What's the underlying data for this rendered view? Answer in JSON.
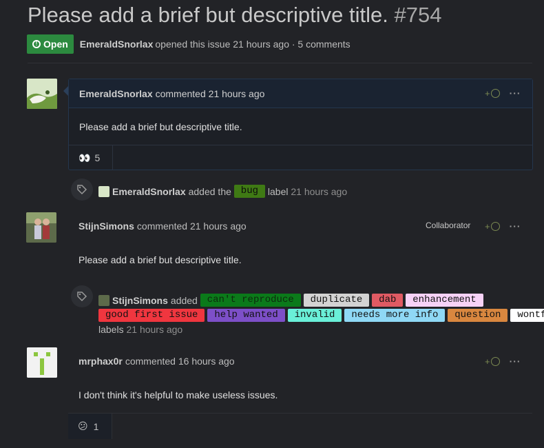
{
  "issue": {
    "title": "Please add a brief but descriptive title.",
    "number": "#754",
    "state": "Open",
    "author": "EmeraldSnorlax",
    "opened_text": "opened this issue 21 hours ago · 5 comments"
  },
  "comments": [
    {
      "author": "EmeraldSnorlax",
      "verb": "commented",
      "time": "21 hours ago",
      "body": "Please add a brief but descriptive title.",
      "reaction": {
        "emoji": "👀",
        "count": "5"
      }
    },
    {
      "author": "StijnSimons",
      "verb": "commented",
      "time": "21 hours ago",
      "role": "Collaborator",
      "body": "Please add a brief but descriptive title."
    },
    {
      "author": "mrphax0r",
      "verb": "commented",
      "time": "16 hours ago",
      "body": "I don't think it's helpful to make useless issues.",
      "reaction": {
        "emoji": "😕",
        "count": "1"
      }
    }
  ],
  "events": [
    {
      "actor": "EmeraldSnorlax",
      "pre": "added the",
      "label": {
        "text": "bug",
        "bg": "#3f7a14",
        "fg": "#0c0c0c"
      },
      "post": "label",
      "time": "21 hours ago"
    },
    {
      "actor": "StijnSimons",
      "pre": "added",
      "labels": [
        {
          "text": "can't reproduce",
          "bg": "#0b7a1a",
          "fg": "#0d2a0d"
        },
        {
          "text": "duplicate",
          "bg": "#d3d3d3",
          "fg": "#111111"
        },
        {
          "text": "dab",
          "bg": "#e05a63",
          "fg": "#111111"
        },
        {
          "text": "enhancement",
          "bg": "#f7d2f7",
          "fg": "#111111"
        },
        {
          "text": "good first issue",
          "bg": "#f0363f",
          "fg": "#111111"
        },
        {
          "text": "help wanted",
          "bg": "#7d4fc8",
          "fg": "#111111"
        },
        {
          "text": "invalid",
          "bg": "#6af0d8",
          "fg": "#111111"
        },
        {
          "text": "needs more info",
          "bg": "#8fd8f5",
          "fg": "#111111"
        },
        {
          "text": "question",
          "bg": "#d9873f",
          "fg": "#111111"
        },
        {
          "text": "wontfix",
          "bg": "#ffffff",
          "fg": "#111111"
        }
      ],
      "post": "labels",
      "time": "21 hours ago"
    }
  ],
  "ui": {
    "add_reaction": "+",
    "more": "···",
    "tag_icon": "tag-icon"
  }
}
